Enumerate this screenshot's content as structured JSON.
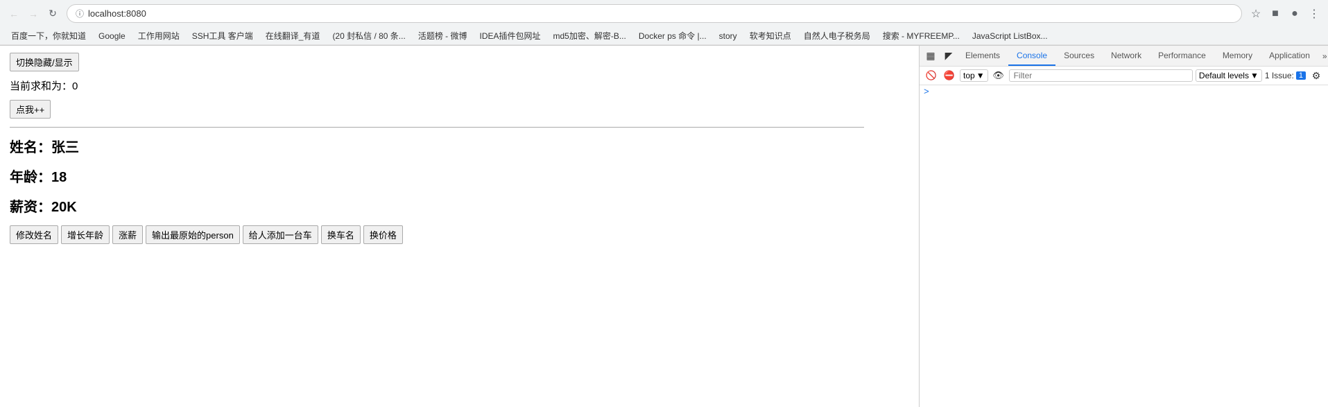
{
  "browser": {
    "url": "localhost:8080",
    "back_disabled": true,
    "forward_disabled": true
  },
  "bookmarks": [
    {
      "label": "百度一下，你就知道"
    },
    {
      "label": "Google"
    },
    {
      "label": "工作用网站"
    },
    {
      "label": "SSH工具 客户端"
    },
    {
      "label": "在线翻译_有道"
    },
    {
      "label": "(20 封私信 / 80 条..."
    },
    {
      "label": "活题榜 - 微博"
    },
    {
      "label": "IDEA插件包网址"
    },
    {
      "label": "md5加密、解密-B..."
    },
    {
      "label": "Docker ps 命令 |..."
    },
    {
      "label": "story"
    },
    {
      "label": "软考知识点"
    },
    {
      "label": "自然人电子税务局"
    },
    {
      "label": "搜索 - MYFREEMP..."
    },
    {
      "label": "JavaScript ListBox..."
    }
  ],
  "page": {
    "toggle_btn_label": "切换隐藏/显示",
    "sum_prefix": "当前求和为：",
    "sum_value": "0",
    "click_btn_label": "点我++",
    "person": {
      "name_label": "姓名：",
      "name_value": "张三",
      "age_label": "年龄：",
      "age_value": "18",
      "salary_label": "薪资：",
      "salary_value": "20K"
    },
    "action_buttons": [
      {
        "label": "修改姓名"
      },
      {
        "label": "增长年龄"
      },
      {
        "label": "涨薪"
      },
      {
        "label": "输出最原始的person"
      },
      {
        "label": "给人添加一台车"
      },
      {
        "label": "换车名"
      },
      {
        "label": "换价格"
      }
    ]
  },
  "devtools": {
    "tabs": [
      {
        "label": "Elements",
        "active": false
      },
      {
        "label": "Console",
        "active": true
      },
      {
        "label": "Sources",
        "active": false
      },
      {
        "label": "Network",
        "active": false
      },
      {
        "label": "Performance",
        "active": false
      },
      {
        "label": "Memory",
        "active": false
      },
      {
        "label": "Application",
        "active": false
      }
    ],
    "console": {
      "context": "top",
      "filter_placeholder": "Filter",
      "default_levels": "Default levels",
      "issue_label": "1 Issue:",
      "issue_count": "1",
      "prompt_symbol": ">"
    }
  }
}
